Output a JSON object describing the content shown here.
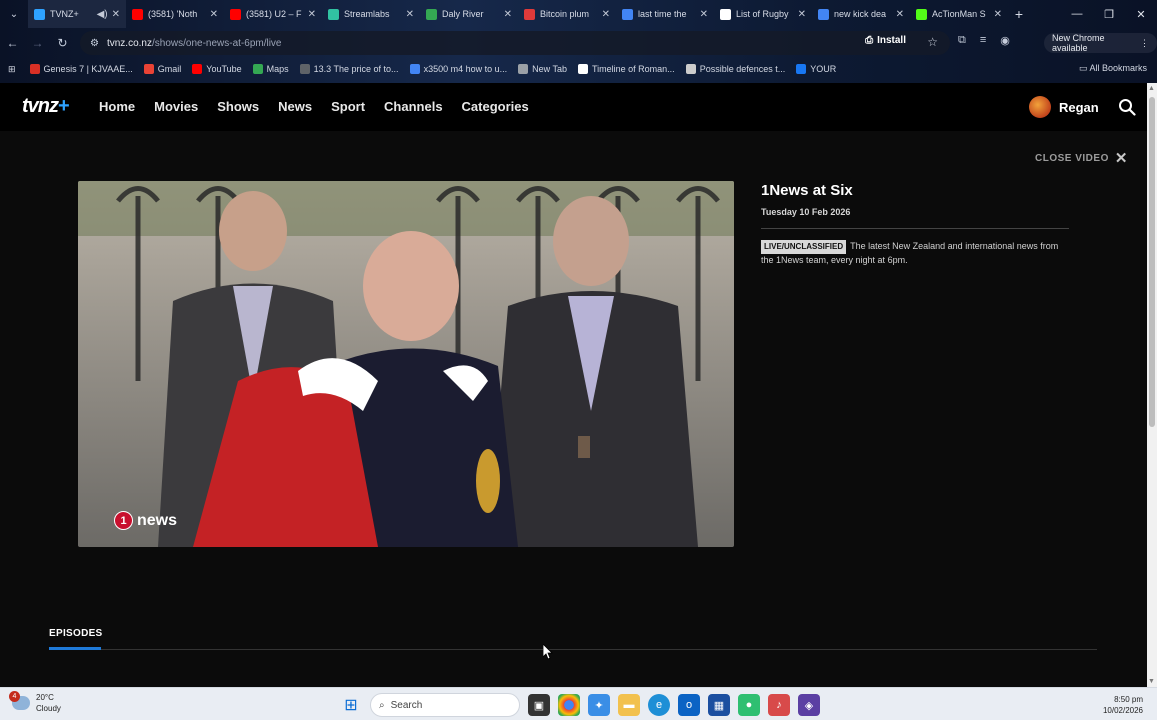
{
  "browser": {
    "tabs": [
      {
        "title": "TVNZ+",
        "icon": "tvnz-favicon",
        "color": "#2ea2ff",
        "active": true,
        "audio": true
      },
      {
        "title": "(3581) 'Noth",
        "icon": "youtube-favicon",
        "color": "#ff0000"
      },
      {
        "title": "(3581) U2 – F",
        "icon": "youtube-favicon",
        "color": "#ff0000"
      },
      {
        "title": "Streamlabs",
        "icon": "streamlabs-favicon",
        "color": "#31c3a2"
      },
      {
        "title": "Daly River",
        "icon": "maps-favicon",
        "color": "#34a853"
      },
      {
        "title": "Bitcoin plum",
        "icon": "bitcoin-favicon",
        "color": "#e03a3a"
      },
      {
        "title": "last time the",
        "icon": "google-favicon",
        "color": "#4285f4"
      },
      {
        "title": "List of Rugby",
        "icon": "wikipedia-favicon",
        "color": "#ffffff"
      },
      {
        "title": "new kick dea",
        "icon": "google-favicon",
        "color": "#4285f4"
      },
      {
        "title": "AcTionMan S",
        "icon": "kick-favicon",
        "color": "#53fc18"
      }
    ],
    "new_tab": "+",
    "url_domain": "tvnz.co.nz",
    "url_path": "/shows/one-news-at-6pm/live",
    "install_label": "Install",
    "new_chrome_label": "New Chrome available",
    "bookmarks": [
      {
        "label": "Genesis 7 | KJVAAE...",
        "color": "#d93025"
      },
      {
        "label": "Gmail",
        "color": "#ea4335"
      },
      {
        "label": "YouTube",
        "color": "#ff0000"
      },
      {
        "label": "Maps",
        "color": "#34a853"
      },
      {
        "label": "13.3 The price of to...",
        "color": "#5f6368"
      },
      {
        "label": "x3500 m4 how to u...",
        "color": "#4285f4"
      },
      {
        "label": "New Tab",
        "color": "#9aa0a6"
      },
      {
        "label": "Timeline of Roman...",
        "color": "#ffffff"
      },
      {
        "label": "Possible defences t...",
        "color": "#cccccc"
      },
      {
        "label": "YOUR",
        "color": "#1877f2"
      }
    ],
    "all_bookmarks_label": "All Bookmarks"
  },
  "site": {
    "logo_text": "tvnz",
    "logo_plus": "+",
    "nav": [
      "Home",
      "Movies",
      "Shows",
      "News",
      "Sport",
      "Channels",
      "Categories"
    ],
    "user_name": "Regan"
  },
  "player": {
    "close_label": "CLOSE VIDEO",
    "watermark_number": "1",
    "watermark_text": "news"
  },
  "show": {
    "title": "1News at Six",
    "date": "Tuesday 10 Feb 2026",
    "badge": "LIVE/UNCLASSIFIED",
    "description": "The latest New Zealand and international news from the 1News team, every night at 6pm."
  },
  "episodes_label": "EPISODES",
  "taskbar": {
    "temperature": "20°C",
    "condition": "Cloudy",
    "weather_badge": "4",
    "search_placeholder": "Search",
    "time": "8:50 pm",
    "date": "10/02/2026"
  },
  "colors": {
    "accent_blue": "#1f7ad9",
    "tvnz_plus": "#2ea2ff",
    "onenews_red": "#c8102e"
  }
}
